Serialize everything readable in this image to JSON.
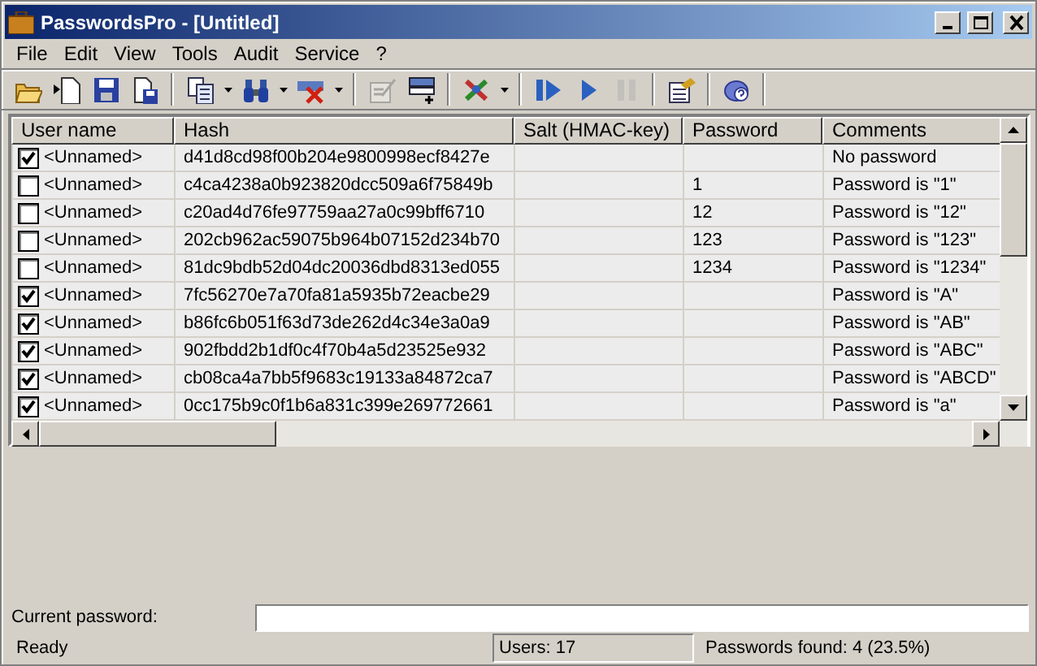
{
  "window": {
    "title": "PasswordsPro - [Untitled]"
  },
  "menu": [
    "File",
    "Edit",
    "View",
    "Tools",
    "Audit",
    "Service",
    "?"
  ],
  "toolbar": [
    {
      "kind": "open",
      "disabled": false,
      "dropdown": false,
      "group_end": false
    },
    {
      "kind": "new",
      "disabled": false,
      "dropdown": false,
      "group_end": false
    },
    {
      "kind": "save",
      "disabled": false,
      "dropdown": false,
      "group_end": false
    },
    {
      "kind": "saveas",
      "disabled": false,
      "dropdown": false,
      "group_end": true
    },
    {
      "kind": "copy",
      "disabled": false,
      "dropdown": true,
      "group_end": false
    },
    {
      "kind": "find",
      "disabled": false,
      "dropdown": true,
      "group_end": false
    },
    {
      "kind": "delete",
      "disabled": false,
      "dropdown": true,
      "group_end": true
    },
    {
      "kind": "edit",
      "disabled": true,
      "dropdown": false,
      "group_end": false
    },
    {
      "kind": "add",
      "disabled": false,
      "dropdown": false,
      "group_end": true
    },
    {
      "kind": "tools",
      "disabled": false,
      "dropdown": true,
      "group_end": true
    },
    {
      "kind": "start",
      "disabled": false,
      "dropdown": false,
      "group_end": false
    },
    {
      "kind": "play",
      "disabled": false,
      "dropdown": false,
      "group_end": false
    },
    {
      "kind": "pause",
      "disabled": true,
      "dropdown": false,
      "group_end": true
    },
    {
      "kind": "properties",
      "disabled": false,
      "dropdown": false,
      "group_end": true
    },
    {
      "kind": "help",
      "disabled": false,
      "dropdown": false,
      "group_end": true
    }
  ],
  "table": {
    "columns": [
      "User name",
      "Hash",
      "Salt (HMAC-key)",
      "Password",
      "Comments"
    ],
    "rows": [
      {
        "checked": true,
        "user": "<Unnamed>",
        "hash": "d41d8cd98f00b204e9800998ecf8427e",
        "password": "",
        "comment": "No password"
      },
      {
        "checked": false,
        "user": "<Unnamed>",
        "hash": "c4ca4238a0b923820dcc509a6f75849b",
        "password": "1",
        "comment": "Password is \"1\""
      },
      {
        "checked": false,
        "user": "<Unnamed>",
        "hash": "c20ad4d76fe97759aa27a0c99bff6710",
        "password": "12",
        "comment": "Password is \"12\""
      },
      {
        "checked": false,
        "user": "<Unnamed>",
        "hash": "202cb962ac59075b964b07152d234b70",
        "password": "123",
        "comment": "Password is \"123\""
      },
      {
        "checked": false,
        "user": "<Unnamed>",
        "hash": "81dc9bdb52d04dc20036dbd8313ed055",
        "password": "1234",
        "comment": "Password is \"1234\""
      },
      {
        "checked": true,
        "user": "<Unnamed>",
        "hash": "7fc56270e7a70fa81a5935b72eacbe29",
        "password": "",
        "comment": "Password is \"A\""
      },
      {
        "checked": true,
        "user": "<Unnamed>",
        "hash": "b86fc6b051f63d73de262d4c34e3a0a9",
        "password": "",
        "comment": "Password is \"AB\""
      },
      {
        "checked": true,
        "user": "<Unnamed>",
        "hash": "902fbdd2b1df0c4f70b4a5d23525e932",
        "password": "",
        "comment": "Password is \"ABC\""
      },
      {
        "checked": true,
        "user": "<Unnamed>",
        "hash": "cb08ca4a7bb5f9683c19133a84872ca7",
        "password": "",
        "comment": "Password is \"ABCD\""
      },
      {
        "checked": true,
        "user": "<Unnamed>",
        "hash": "0cc175b9c0f1b6a831c399e269772661",
        "password": "",
        "comment": "Password is \"a\""
      }
    ]
  },
  "current_password": {
    "label": "Current password:"
  },
  "status_bar": [
    "Ready",
    "Users: 17",
    "Passwords found: 4 (23.5%)"
  ]
}
